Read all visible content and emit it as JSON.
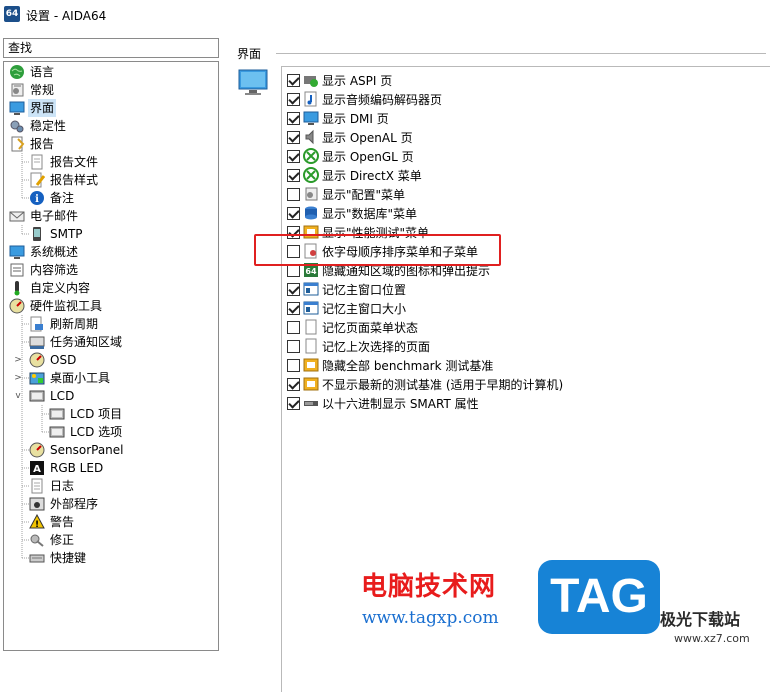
{
  "window": {
    "icon_text": "64",
    "title": "设置 - AIDA64"
  },
  "search": {
    "label": "查找"
  },
  "tree": {
    "items": [
      {
        "label": "语言",
        "icon": "globe-icon"
      },
      {
        "label": "常规",
        "icon": "gear-list-icon"
      },
      {
        "label": "界面",
        "icon": "monitor-icon",
        "selected": true
      },
      {
        "label": "稳定性",
        "icon": "gears-icon"
      },
      {
        "label": "报告",
        "icon": "report-icon"
      },
      {
        "label": "报告文件",
        "icon": "document-icon"
      },
      {
        "label": "报告样式",
        "icon": "document-pen-icon"
      },
      {
        "label": "备注",
        "icon": "info-icon"
      },
      {
        "label": "电子邮件",
        "icon": "email-icon"
      },
      {
        "label": "SMTP",
        "icon": "phone-icon"
      },
      {
        "label": "系统概述",
        "icon": "monitor-icon"
      },
      {
        "label": "内容筛选",
        "icon": "filter-icon"
      },
      {
        "label": "自定义内容",
        "icon": "thermometer-icon"
      },
      {
        "label": "硬件监视工具",
        "icon": "gauge-icon"
      },
      {
        "label": "刷新周期",
        "icon": "refresh-doc-icon"
      },
      {
        "label": "任务通知区域",
        "icon": "taskbar-icon"
      },
      {
        "label": "OSD",
        "icon": "gauge-icon"
      },
      {
        "label": "桌面小工具",
        "icon": "gadget-icon"
      },
      {
        "label": "LCD",
        "icon": "lcd-icon"
      },
      {
        "label": "LCD 项目",
        "icon": "lcd-icon"
      },
      {
        "label": "LCD 选项",
        "icon": "lcd-icon"
      },
      {
        "label": "SensorPanel",
        "icon": "gauge-icon"
      },
      {
        "label": "RGB LED",
        "icon": "rgb-icon"
      },
      {
        "label": "日志",
        "icon": "log-icon"
      },
      {
        "label": "外部程序",
        "icon": "program-icon"
      },
      {
        "label": "警告",
        "icon": "warning-icon"
      },
      {
        "label": "修正",
        "icon": "wrench-icon"
      },
      {
        "label": "快捷键",
        "icon": "keyboard-icon"
      }
    ]
  },
  "main": {
    "section_title": "界面",
    "options": [
      {
        "label": "显示 ASPI 页",
        "checked": true,
        "icon": "aspi-icon"
      },
      {
        "label": "显示音频编码解码器页",
        "checked": true,
        "icon": "audio-icon"
      },
      {
        "label": "显示 DMI 页",
        "checked": true,
        "icon": "monitor-icon"
      },
      {
        "label": "显示 OpenAL 页",
        "checked": true,
        "icon": "speaker-icon"
      },
      {
        "label": "显示 OpenGL 页",
        "checked": true,
        "icon": "xbox-icon"
      },
      {
        "label": "显示 DirectX 菜单",
        "checked": true,
        "icon": "xbox-icon"
      },
      {
        "label": "显示\"配置\"菜单",
        "checked": false,
        "icon": "gear-list-icon"
      },
      {
        "label": "显示\"数据库\"菜单",
        "checked": true,
        "icon": "database-icon"
      },
      {
        "label": "显示\"性能测试\"菜单",
        "checked": true,
        "icon": "benchmark-icon"
      },
      {
        "label": "依字母顺序排序菜单和子菜单",
        "checked": false,
        "icon": "sort-icon"
      },
      {
        "label": "隐藏通知区域的图标和弹出提示",
        "checked": false,
        "icon": "aida-icon"
      },
      {
        "label": "记忆主窗口位置",
        "checked": true,
        "icon": "window-icon"
      },
      {
        "label": "记忆主窗口大小",
        "checked": true,
        "icon": "window-icon"
      },
      {
        "label": "记忆页面菜单状态",
        "checked": false,
        "icon": "page-icon"
      },
      {
        "label": "记忆上次选择的页面",
        "checked": false,
        "icon": "page-icon"
      },
      {
        "label": "隐藏全部 benchmark 测试基准",
        "checked": false,
        "icon": "benchmark-icon"
      },
      {
        "label": "不显示最新的测试基准 (适用于早期的计算机)",
        "checked": true,
        "icon": "benchmark-icon"
      },
      {
        "label": "以十六进制显示 SMART 属性",
        "checked": true,
        "icon": "drive-icon"
      }
    ]
  },
  "watermark": {
    "text": "电脑技术网",
    "url": "www.tagxp.com",
    "tag": "TAG",
    "site": "极光下载站",
    "site_url": "www.xz7.com"
  },
  "colors": {
    "selection": "#cce4f7",
    "highlight_box": "#e02020",
    "watermark_red": "#e81c1c",
    "watermark_blue": "#1783d6"
  }
}
